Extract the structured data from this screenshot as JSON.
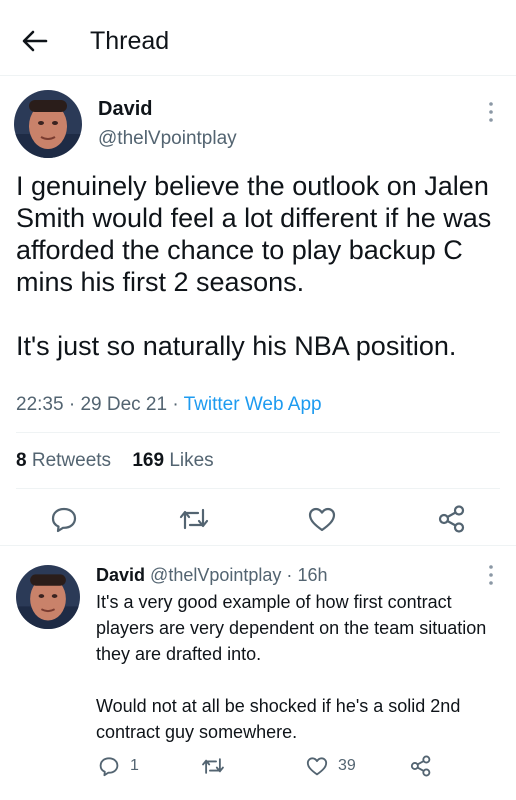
{
  "header": {
    "title": "Thread",
    "back_icon": "arrow-left-icon"
  },
  "main_tweet": {
    "author": {
      "name": "David",
      "handle": "@thelVpointplay"
    },
    "text": "I genuinely believe the outlook on Jalen Smith would feel a lot different if he was afforded the chance to play backup C mins his first 2 seasons.\n\nIt's just so naturally his NBA position.",
    "time": "22:35",
    "date": "29 Dec 21",
    "source": "Twitter Web App",
    "separator": "·",
    "stats": {
      "retweets_count": "8",
      "retweets_label": "Retweets",
      "likes_count": "169",
      "likes_label": "Likes"
    },
    "actions": [
      "reply-icon",
      "retweet-icon",
      "like-icon",
      "share-icon"
    ]
  },
  "reply": {
    "author": {
      "name": "David",
      "handle": "@thelVpointplay"
    },
    "separator": "·",
    "time": "16h",
    "text": "It's a very good example of how first contract players are very dependent on the team situation they are drafted into.\n\nWould not at all be shocked if he's a solid 2nd contract guy somewhere.",
    "reply_count": "1",
    "like_count": "39"
  },
  "colors": {
    "text": "#0f1419",
    "secondary": "#536471",
    "link": "#1d9bf0",
    "divider": "#eff3f4"
  }
}
